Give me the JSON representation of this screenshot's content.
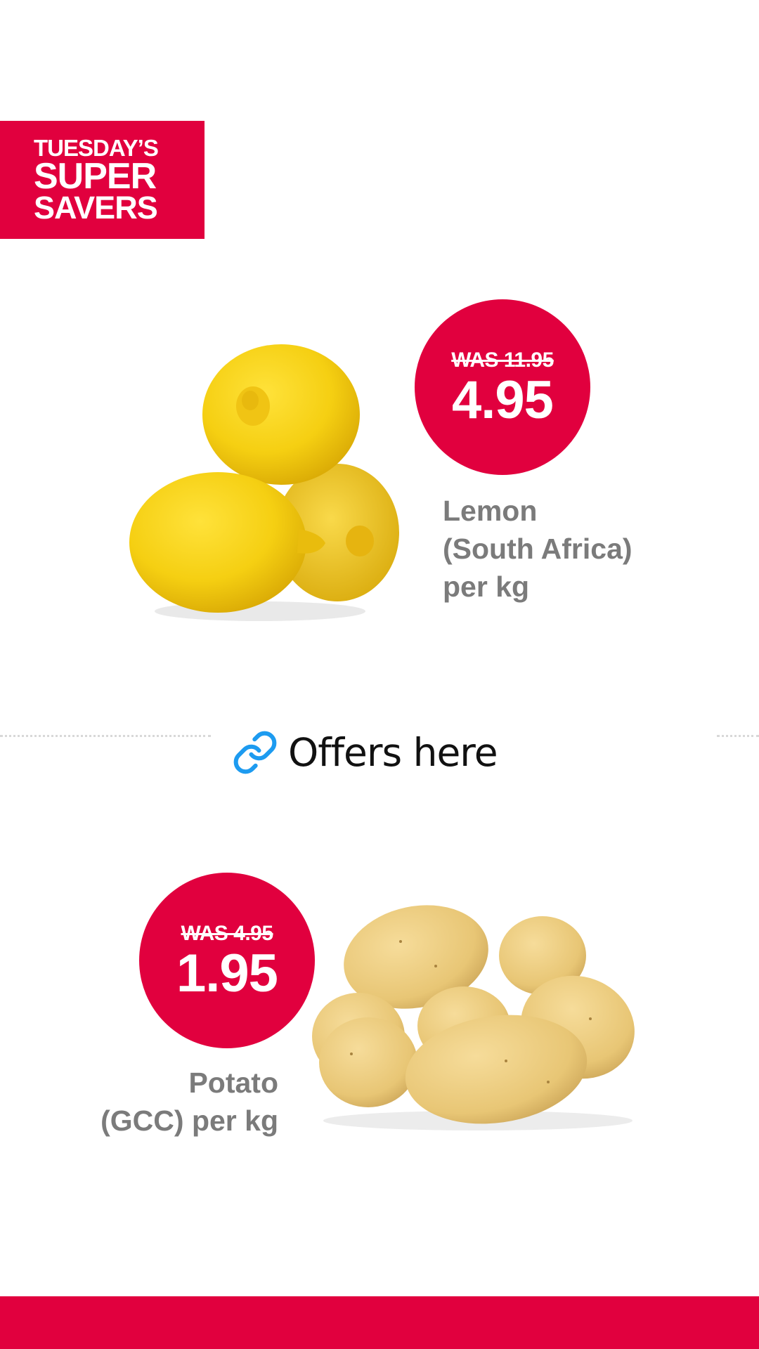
{
  "banner": {
    "line1": "TUESDAY’S",
    "line2": "SUPER",
    "line3": "SAVERS"
  },
  "products": [
    {
      "was": "WAS 11.95",
      "price": "4.95",
      "name_lines": [
        "Lemon",
        "(South Africa)",
        "per kg"
      ],
      "image": "lemons-image"
    },
    {
      "was": "WAS 4.95",
      "price": "1.95",
      "name_lines": [
        "Potato",
        "(GCC) per kg"
      ],
      "image": "potatoes-image"
    }
  ],
  "offers_link": {
    "label": "Offers here",
    "icon": "link-icon"
  },
  "colors": {
    "brand_red": "#e1003e",
    "name_gray": "#7b7b7b",
    "link_blue": "#1d9bf0"
  }
}
